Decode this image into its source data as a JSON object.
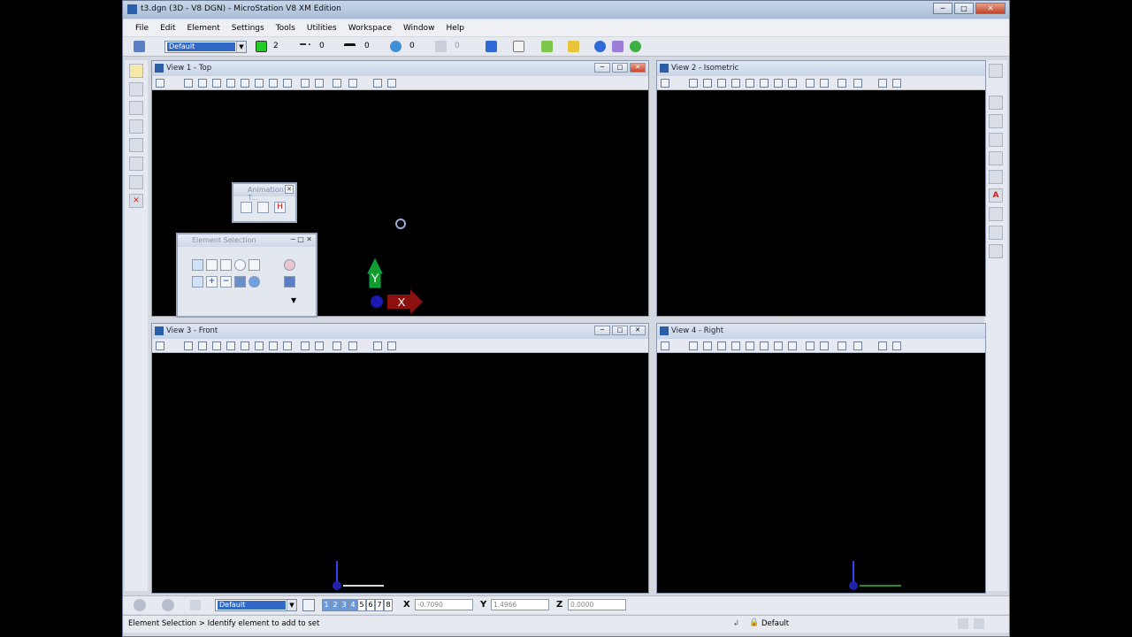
{
  "window": {
    "title": "t3.dgn (3D - V8 DGN) - MicroStation V8 XM Edition"
  },
  "menu": [
    "File",
    "Edit",
    "Element",
    "Settings",
    "Tools",
    "Utilities",
    "Workspace",
    "Window",
    "Help"
  ],
  "attributes": {
    "level": "Default",
    "color": "2",
    "color_hex": "#22cc22",
    "style": "0",
    "weight": "0",
    "transparency": "0",
    "priority": "0"
  },
  "views": [
    {
      "title": "View 1 - Top"
    },
    {
      "title": "View 2 - Isometric"
    },
    {
      "title": "View 3 - Front"
    },
    {
      "title": "View 4 - Right"
    }
  ],
  "dialogs": {
    "animation": {
      "title": "Animation T..."
    },
    "element_selection": {
      "title": "Element Selection"
    }
  },
  "axis": {
    "y": "Y",
    "x": "X"
  },
  "status": {
    "level": "Default",
    "view_numbers": [
      "1",
      "2",
      "3",
      "4",
      "5",
      "6",
      "7",
      "8"
    ],
    "x_label": "X",
    "x_value": "-0.7090",
    "y_label": "Y",
    "y_value": "1.4966",
    "z_label": "Z",
    "z_value": "0.0000",
    "prompt": "Element Selection > Identify element to add to set",
    "active_level": "Default"
  }
}
